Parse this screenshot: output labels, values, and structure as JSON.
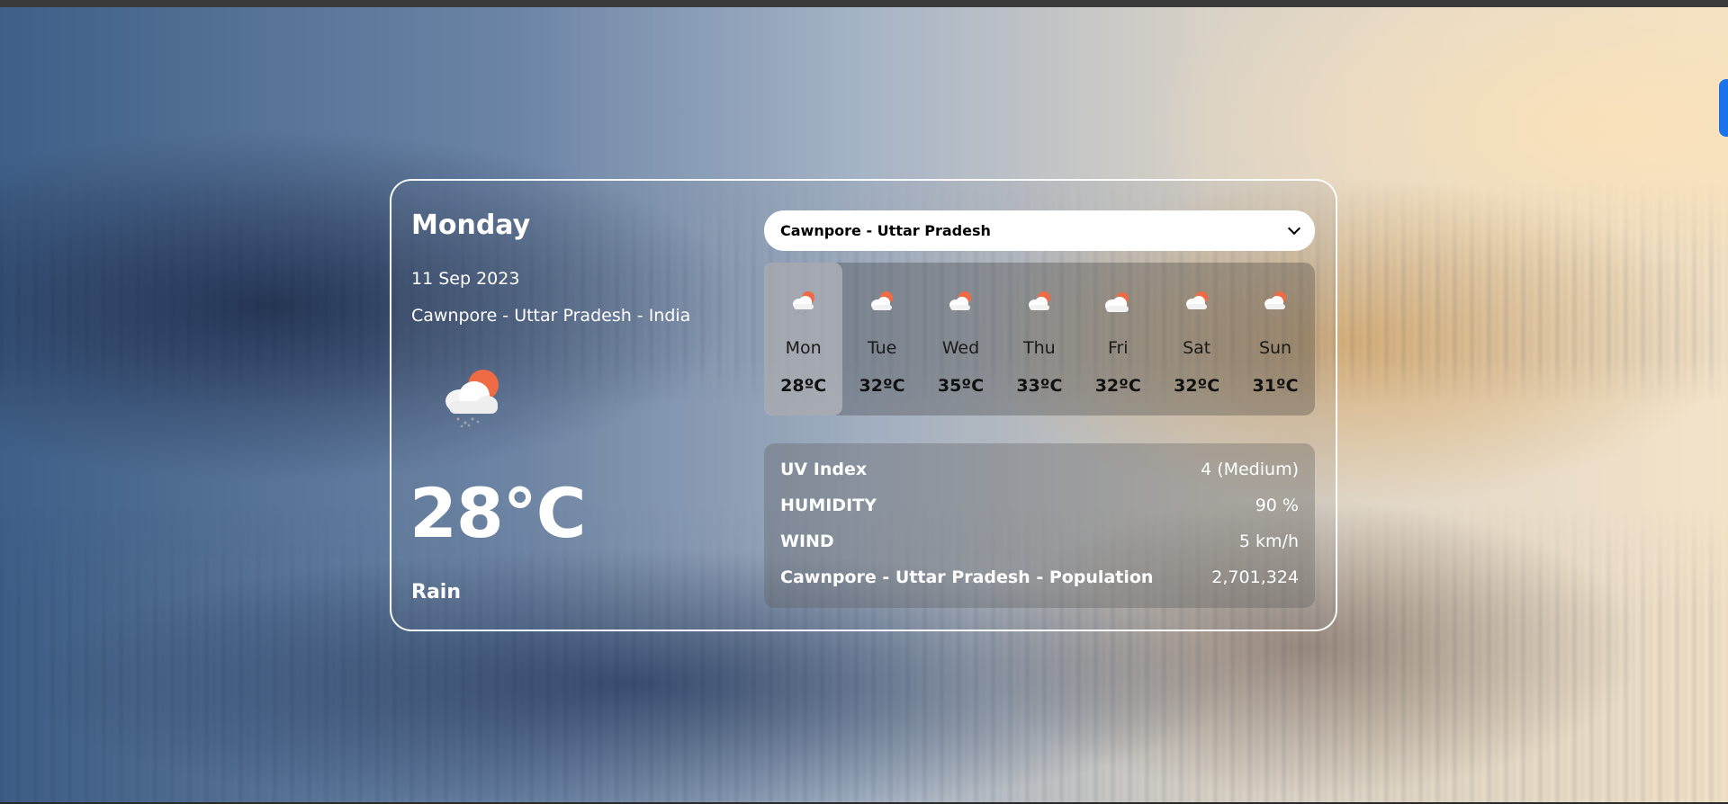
{
  "current": {
    "day": "Monday",
    "date": "11 Sep 2023",
    "location": "Cawnpore - Uttar Pradesh - India",
    "temperature": "28°C",
    "condition": "Rain",
    "icon": "cloud-sun-rain-icon"
  },
  "city_select": {
    "selected": "Cawnpore - Uttar Pradesh"
  },
  "forecast": [
    {
      "day": "Mon",
      "temp": "28ºC",
      "icon": "cloud-sun-rain-icon",
      "active": true
    },
    {
      "day": "Tue",
      "temp": "32ºC",
      "icon": "cloud-sun-icon"
    },
    {
      "day": "Wed",
      "temp": "35ºC",
      "icon": "cloud-sun-icon"
    },
    {
      "day": "Thu",
      "temp": "33ºC",
      "icon": "cloud-sun-icon"
    },
    {
      "day": "Fri",
      "temp": "32ºC",
      "icon": "cloud-sun-icon"
    },
    {
      "day": "Sat",
      "temp": "32ºC",
      "icon": "cloud-sun-rain-icon"
    },
    {
      "day": "Sun",
      "temp": "31ºC",
      "icon": "cloud-sun-rain-icon"
    }
  ],
  "stats": [
    {
      "label": "UV Index",
      "value": "4 (Medium)"
    },
    {
      "label": "HUMIDITY",
      "value": "90 %"
    },
    {
      "label": "WIND",
      "value": "5 km/h"
    },
    {
      "label": "Cawnpore - Uttar Pradesh - Population",
      "value": "2,701,324"
    }
  ],
  "colors": {
    "sun": "#ee6b45",
    "cloud": "#f2f2f2",
    "select_bg": "#ffffff",
    "side_tab": "#1a73e8"
  }
}
